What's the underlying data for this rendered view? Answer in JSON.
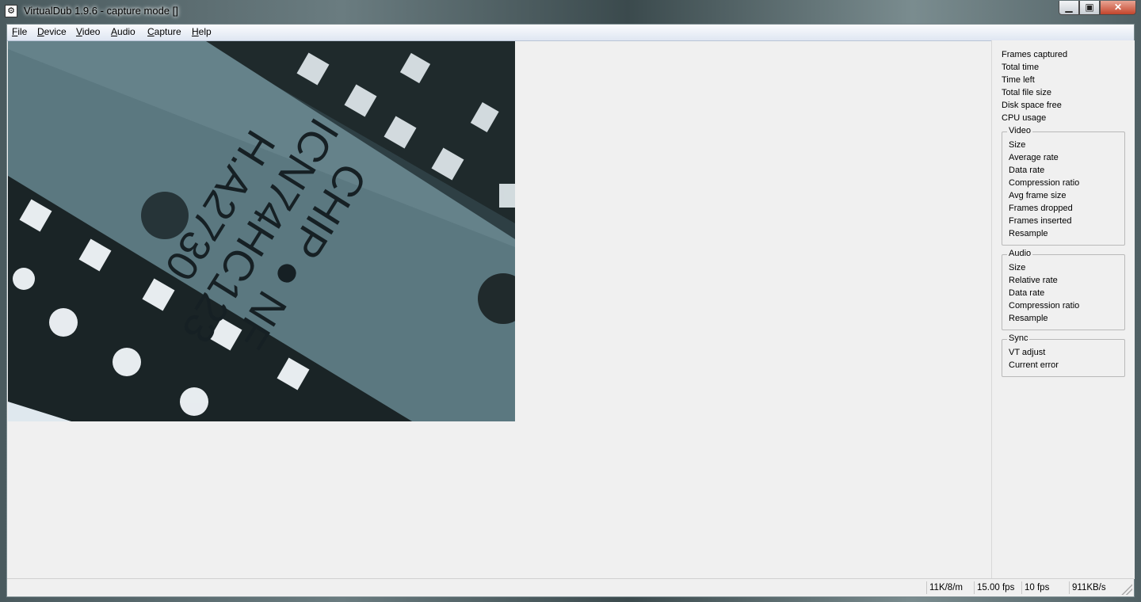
{
  "window": {
    "title": "VirtualDub 1.9.6 - capture mode []",
    "icon": "gear-film-icon",
    "caption_buttons": {
      "minimize": "minimize-icon",
      "maximize": "maximize-icon",
      "close": "close-icon"
    }
  },
  "menu": [
    {
      "label": "File",
      "accel": "F",
      "rest": "ile"
    },
    {
      "label": "Device",
      "accel": "D",
      "rest": "evice"
    },
    {
      "label": "Video",
      "accel": "V",
      "rest": "ideo"
    },
    {
      "label": "Audio",
      "accel": "A",
      "rest": "udio"
    },
    {
      "label": "Capture",
      "accel": "C",
      "rest": "apture"
    },
    {
      "label": "Help",
      "accel": "H",
      "rest": "elp"
    }
  ],
  "preview": {
    "chip_text_line1": "CHIP ● NF",
    "chip_text_line2": "ICN74HC123",
    "chip_text_line3": "H.A2730"
  },
  "stats": {
    "general": [
      "Frames captured",
      "Total time",
      "Time left",
      "Total file size",
      "Disk space free",
      "CPU usage"
    ],
    "video": {
      "title": "Video",
      "items": [
        "Size",
        "Average rate",
        "Data rate",
        "Compression ratio",
        "Avg frame size",
        "Frames dropped",
        "Frames inserted",
        "Resample"
      ]
    },
    "audio": {
      "title": "Audio",
      "items": [
        "Size",
        "Relative rate",
        "Data rate",
        "Compression ratio",
        "Resample"
      ]
    },
    "sync": {
      "title": "Sync",
      "items": [
        "VT adjust",
        "Current error"
      ]
    }
  },
  "statusbar": {
    "format": "11K/8/m",
    "fps": "15.00 fps",
    "target_fps": "10 fps",
    "rate": "911KB/s"
  }
}
